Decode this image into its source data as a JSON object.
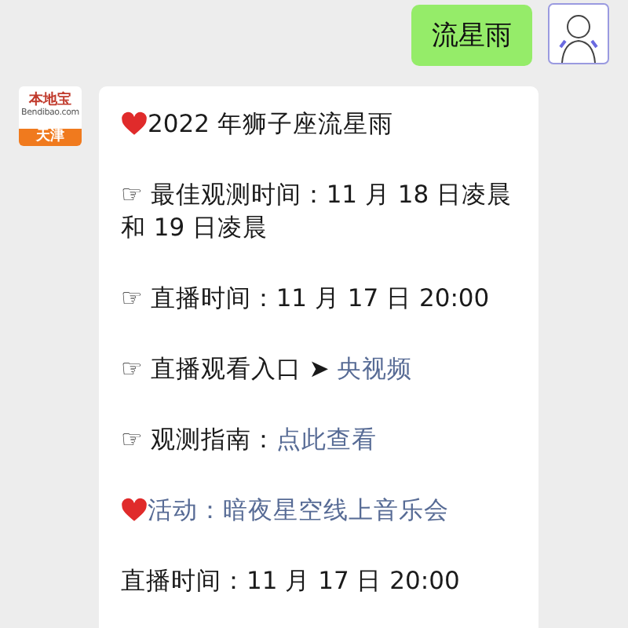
{
  "outgoing": {
    "text": "流星雨"
  },
  "sender": {
    "logo": "本地宝",
    "domain": "Bendibao.com",
    "city": "天津"
  },
  "message": {
    "paragraphs": [
      {
        "kind": "heart",
        "segments": [
          {
            "text": "2022 年狮子座流星雨",
            "link": false
          }
        ]
      },
      {
        "kind": "plain",
        "segments": [
          {
            "text": "☞ 最佳观测时间：11 月 18 日凌晨和 19 日凌晨",
            "link": false
          }
        ]
      },
      {
        "kind": "plain",
        "segments": [
          {
            "text": "☞ 直播时间：11 月 17 日 20:00",
            "link": false
          }
        ]
      },
      {
        "kind": "plain",
        "segments": [
          {
            "text": "☞ 直播观看入口 ➤ ",
            "link": false
          },
          {
            "text": "央视频",
            "link": true
          }
        ]
      },
      {
        "kind": "plain",
        "segments": [
          {
            "text": "☞ 观测指南：",
            "link": false
          },
          {
            "text": "点此查看",
            "link": true
          }
        ]
      },
      {
        "kind": "heart",
        "segments": [
          {
            "text": "活动：暗夜星空线上音乐会",
            "link": true
          }
        ]
      },
      {
        "kind": "plain",
        "segments": [
          {
            "text": "直播时间：11 月 17 日 20:00",
            "link": false
          }
        ]
      }
    ]
  }
}
